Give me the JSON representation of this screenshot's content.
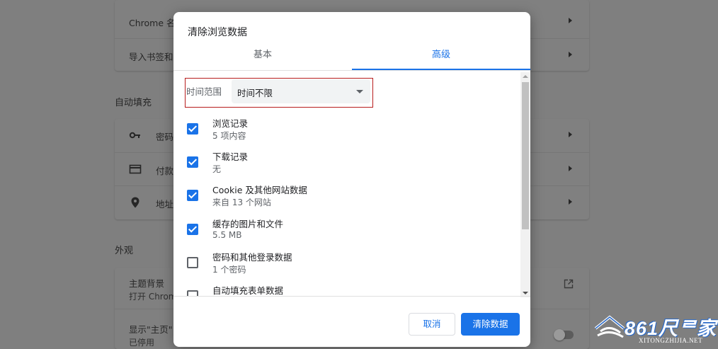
{
  "background": {
    "top_card": {
      "rows": [
        {
          "label": "Chrome 名"
        },
        {
          "label": "导入书签和"
        }
      ]
    },
    "autofill": {
      "heading": "自动填充",
      "rows": [
        {
          "label": "密码",
          "icon": "key-icon"
        },
        {
          "label": "付款",
          "icon": "credit-card-icon"
        },
        {
          "label": "地址",
          "icon": "location-pin-icon"
        }
      ]
    },
    "appearance": {
      "heading": "外观",
      "theme_title": "主题背景",
      "theme_subtitle": "打开 Chrom",
      "home_title": "显示\"主页\"",
      "home_subtitle": "已停用"
    }
  },
  "dialog": {
    "title": "清除浏览数据",
    "tabs": [
      {
        "label": "基本",
        "active": false
      },
      {
        "label": "高级",
        "active": true
      }
    ],
    "time_range_label": "时间范围",
    "time_range_value": "时间不限",
    "options": [
      {
        "label": "浏览记录",
        "sub": "5 项内容",
        "checked": true
      },
      {
        "label": "下载记录",
        "sub": "无",
        "checked": true
      },
      {
        "label": "Cookie 及其他网站数据",
        "sub": "来自 13 个网站",
        "checked": true
      },
      {
        "label": "缓存的图片和文件",
        "sub": "5.5 MB",
        "checked": true
      },
      {
        "label": "密码和其他登录数据",
        "sub": "1 个密码",
        "checked": false
      },
      {
        "label": "自动填充表单数据",
        "sub": "",
        "checked": false
      }
    ],
    "cancel_label": "取消",
    "clear_label": "清除数据"
  },
  "watermark": {
    "brand": "861尺ᄅ家",
    "domain": "XITONGZHIJIA.NET"
  },
  "colors": {
    "accent": "#1a73e8",
    "highlight_border": "#b71c1c",
    "overlay": "#7f7f7f"
  }
}
